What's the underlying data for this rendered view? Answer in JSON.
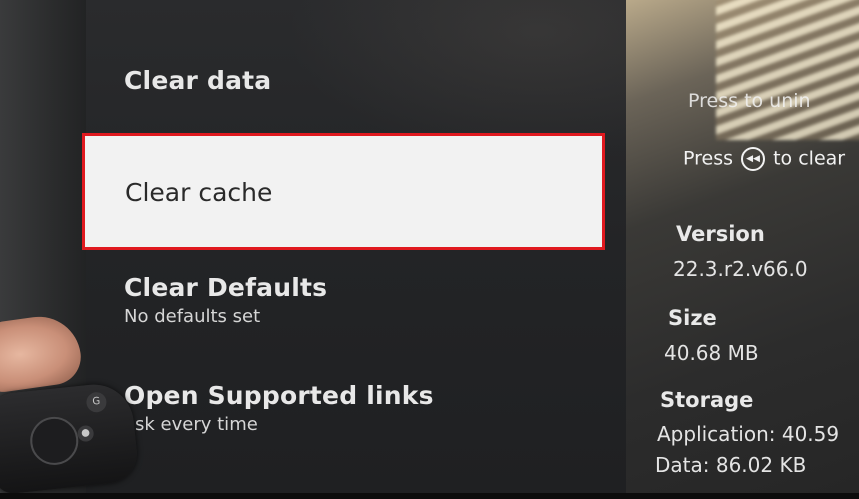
{
  "menu": {
    "items": [
      {
        "label": "Clear data",
        "sublabel": ""
      },
      {
        "label": "Clear cache",
        "sublabel": "",
        "selected": true
      },
      {
        "label": "Clear Defaults",
        "sublabel": "No defaults set"
      },
      {
        "label": "Open Supported links",
        "sublabel": "ask every time"
      }
    ]
  },
  "info": {
    "hint_top": "Press",
    "hint_top_partial": "to unin",
    "hint_press": "Press",
    "hint_clear": "to clear",
    "version_heading": "Version",
    "version_value": "22.3.r2.v66.0",
    "size_heading": "Size",
    "size_value": "40.68 MB",
    "storage_heading": "Storage",
    "storage_application": "Application: 40.59",
    "storage_data": "Data: 86.02 KB"
  },
  "icons": {
    "rewind": "rewind-icon",
    "remote_top_button": "google-assistant-icon"
  },
  "colors": {
    "selection_border": "#e0191f",
    "selection_fill": "#f2f2f2",
    "panel_bg": "#232426"
  }
}
